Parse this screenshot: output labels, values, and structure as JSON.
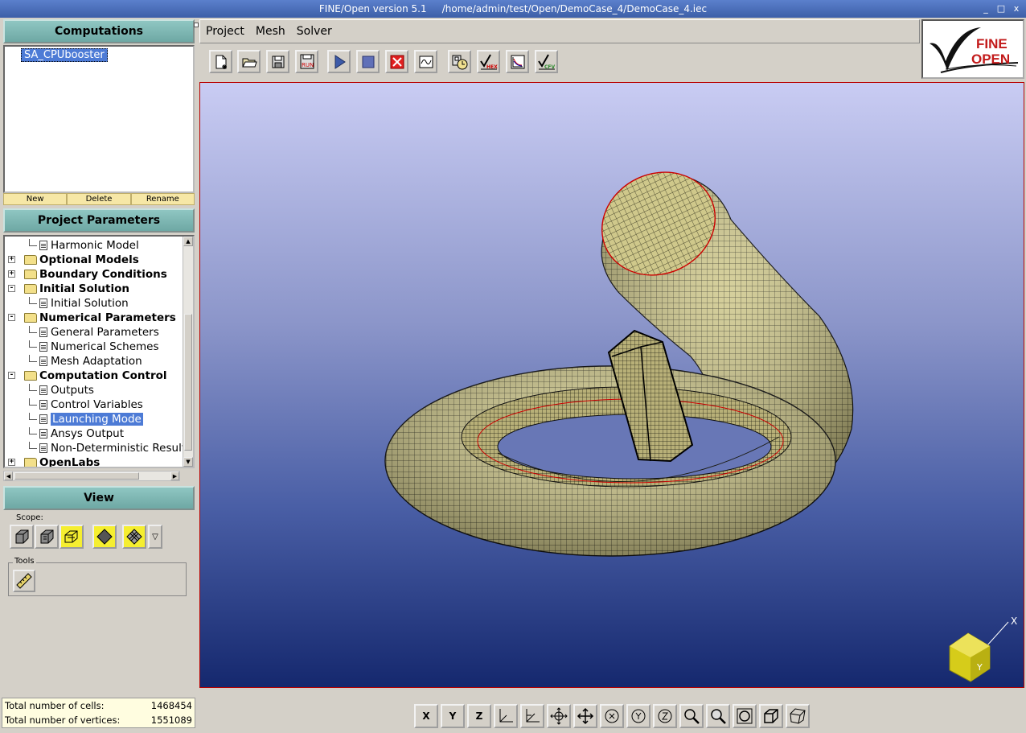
{
  "window": {
    "title": "FINE/Open version 5.1     /home/admin/test/Open/DemoCase_4/DemoCase_4.iec",
    "controls": [
      "_",
      "□",
      "x"
    ]
  },
  "computations": {
    "header": "Computations",
    "items": [
      "SA_CPUbooster"
    ],
    "buttons": {
      "new": "New",
      "delete": "Delete",
      "rename": "Rename"
    }
  },
  "project_parameters": {
    "header": "Project Parameters",
    "tree": [
      {
        "label": "Harmonic Model",
        "type": "leaf",
        "level": 1
      },
      {
        "label": "Optional Models",
        "type": "folder",
        "expander": "+",
        "level": 0
      },
      {
        "label": "Boundary Conditions",
        "type": "folder",
        "expander": "+",
        "level": 0
      },
      {
        "label": "Initial Solution",
        "type": "folder",
        "expander": "-",
        "level": 0
      },
      {
        "label": "Initial Solution",
        "type": "leaf",
        "level": 1
      },
      {
        "label": "Numerical Parameters",
        "type": "folder",
        "expander": "-",
        "level": 0
      },
      {
        "label": "General Parameters",
        "type": "leaf",
        "level": 1
      },
      {
        "label": "Numerical Schemes",
        "type": "leaf",
        "level": 1
      },
      {
        "label": "Mesh Adaptation",
        "type": "leaf",
        "level": 1
      },
      {
        "label": "Computation Control",
        "type": "folder",
        "expander": "-",
        "level": 0
      },
      {
        "label": "Outputs",
        "type": "leaf",
        "level": 1
      },
      {
        "label": "Control Variables",
        "type": "leaf",
        "level": 1
      },
      {
        "label": "Launching Mode",
        "type": "leaf",
        "level": 1,
        "selected": true
      },
      {
        "label": "Ansys Output",
        "type": "leaf",
        "level": 1
      },
      {
        "label": "Non-Deterministic Results",
        "type": "leaf",
        "level": 1
      },
      {
        "label": "OpenLabs",
        "type": "folder",
        "expander": "+",
        "level": 0
      }
    ]
  },
  "view_panel": {
    "header": "View",
    "scope_label": "Scope:",
    "tools_label": "Tools"
  },
  "stats": {
    "cells_label": "Total number of cells:",
    "cells_value": "1468454",
    "vertices_label": "Total number of vertices:",
    "vertices_value": "1551089"
  },
  "menu": {
    "items": [
      "Project",
      "Mesh",
      "Solver"
    ]
  },
  "logo": {
    "line1": "FINE",
    "line2": "OPEN"
  },
  "toolbar": {
    "icons": [
      "new-project-icon",
      "open-project-icon",
      "save-icon",
      "save-run-icon",
      "start-solver-icon",
      "stop-solver-icon",
      "kill-solver-icon",
      "monitor-icon",
      "task-manager-icon",
      "hexstream-icon",
      "plot-icon",
      "cfview-icon"
    ],
    "save_run_text": "RUN",
    "hex_text": "HEX",
    "cfv_text": "CFV"
  },
  "viewport": {
    "axis_x": "X",
    "axis_y": "Y",
    "colors": {
      "mesh_fill": "#c9c285",
      "mesh_line": "#1a1a10",
      "highlight_edge": "#cc0000",
      "axis_cube": "#d6cc1a"
    }
  },
  "view_controls": {
    "x_label": "X",
    "y_label": "Y",
    "z_label": "Z",
    "icons": [
      "view-xy-icon",
      "view-xz-icon",
      "translate-icon",
      "pan-icon",
      "rotate-x-icon",
      "rotate-y-icon",
      "rotate-z-icon",
      "zoom-area-icon",
      "zoom-icon",
      "fit-icon",
      "cube-icon",
      "perspective-icon"
    ]
  }
}
